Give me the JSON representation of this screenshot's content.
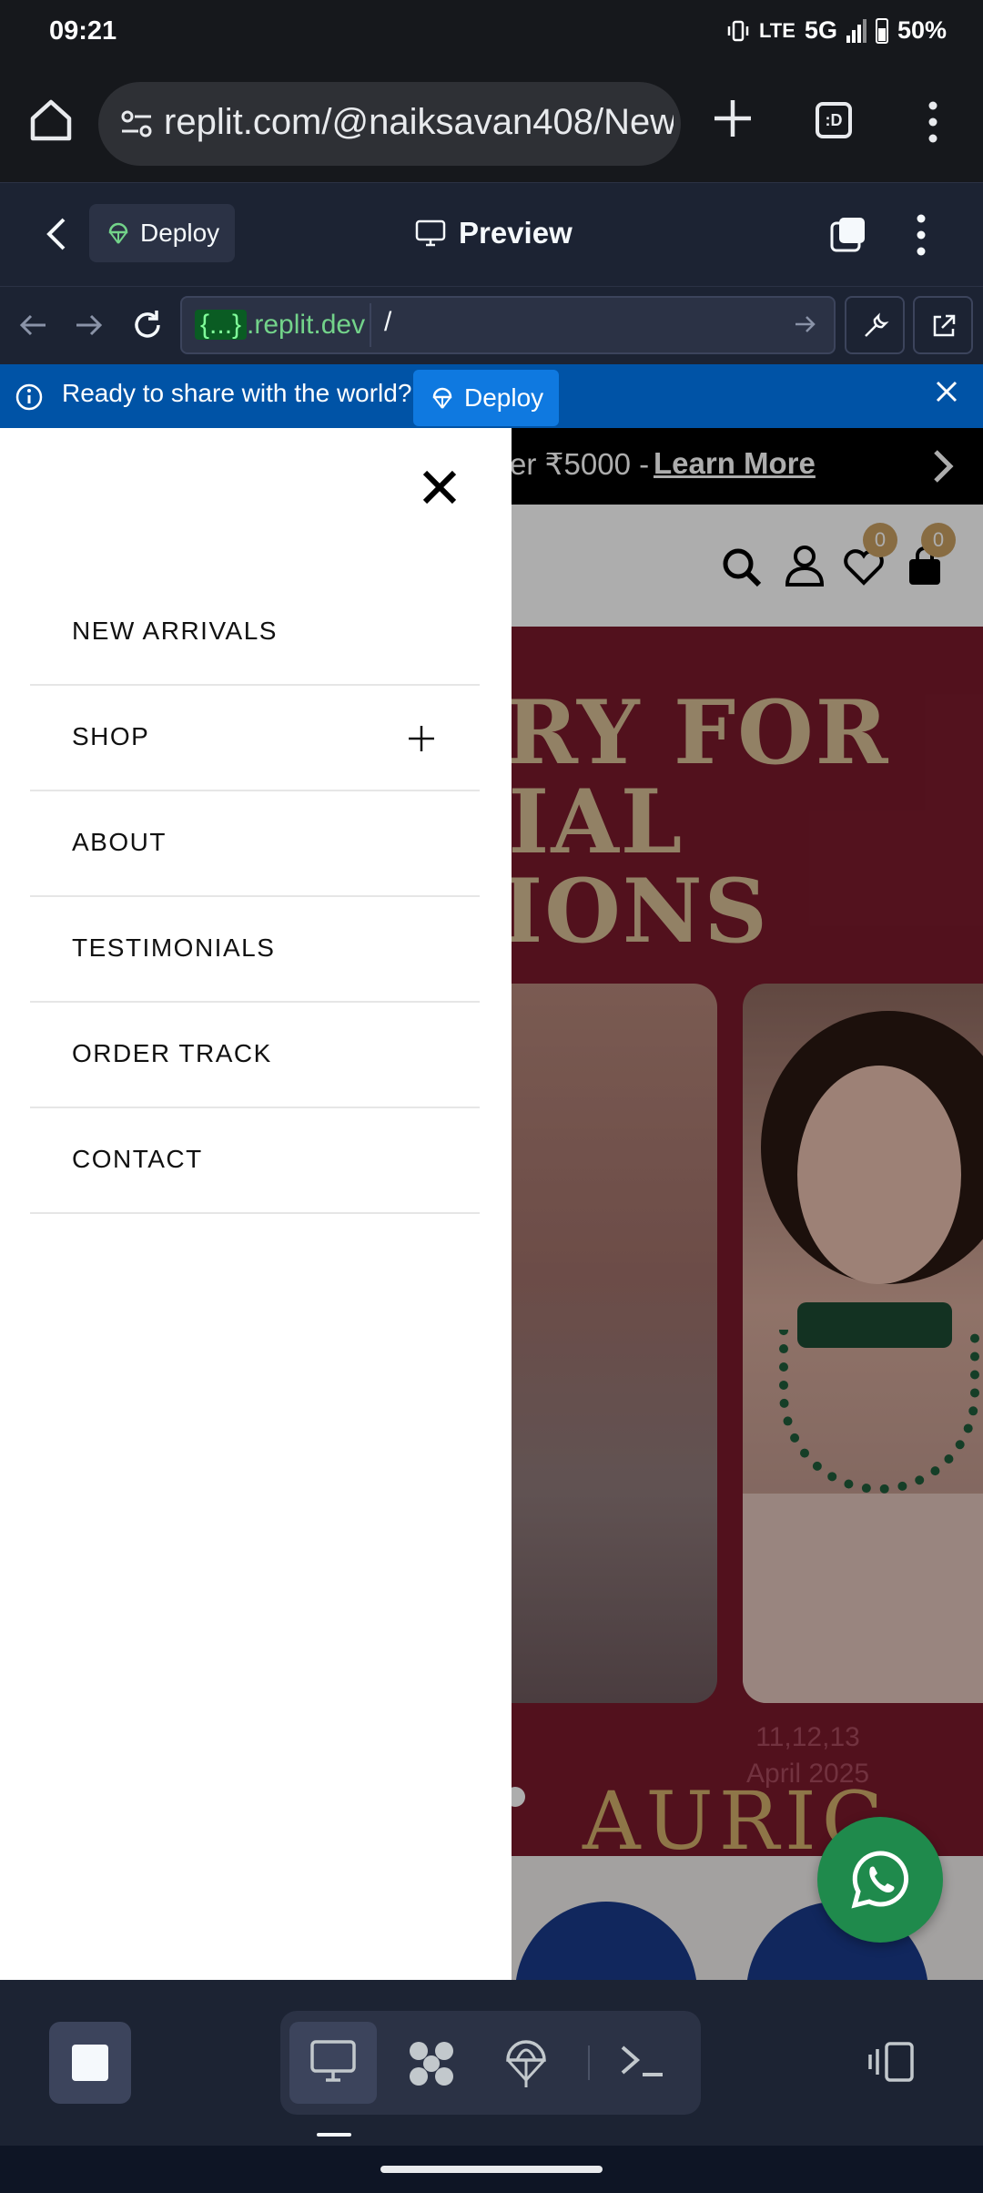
{
  "status_bar": {
    "time": "09:21",
    "network": "5G",
    "battery": "50%"
  },
  "browser": {
    "url": "replit.com/@naiksavan408/New",
    "tab_count_label": ":D"
  },
  "replit_header": {
    "deploy_label": "Deploy",
    "title": "Preview"
  },
  "webview": {
    "host_prefix": "{...}",
    "host_suffix": ".replit.dev",
    "path": "/"
  },
  "banner": {
    "text": "Ready to share with the world?",
    "button_label": "Deploy"
  },
  "site": {
    "promo_text": "er ₹5000 -",
    "promo_link": "Learn More",
    "wishlist_count": "0",
    "cart_count": "0",
    "hero_lines": [
      "ERY FOR",
      "CIAL",
      "SIONS"
    ],
    "hero_date": [
      "11,12,13",
      "April 2025"
    ],
    "hero_brand": "AURIC"
  },
  "drawer": {
    "items": [
      {
        "label": "NEW ARRIVALS",
        "expandable": false
      },
      {
        "label": "SHOP",
        "expandable": true
      },
      {
        "label": "ABOUT",
        "expandable": false
      },
      {
        "label": "TESTIMONIALS",
        "expandable": false
      },
      {
        "label": "ORDER TRACK",
        "expandable": false
      },
      {
        "label": "CONTACT",
        "expandable": false
      }
    ]
  },
  "colors": {
    "replit_bg": "#1c2333",
    "banner_bg": "#0053a6",
    "hero_bg": "#7a1a2c",
    "gold": "#c9a062",
    "whatsapp": "#1f8a4c"
  },
  "icons": [
    "home-icon",
    "site-settings-icon",
    "plus-icon",
    "tabs-icon",
    "more-vert-icon",
    "back-chevron-icon",
    "deploy-icon",
    "monitor-icon",
    "arrow-left-icon",
    "arrow-right-icon",
    "reload-icon",
    "wrench-icon",
    "external-link-icon",
    "info-icon",
    "close-icon",
    "search-icon",
    "user-icon",
    "heart-icon",
    "bag-icon",
    "whatsapp-icon",
    "stop-icon",
    "shell-icon"
  ]
}
